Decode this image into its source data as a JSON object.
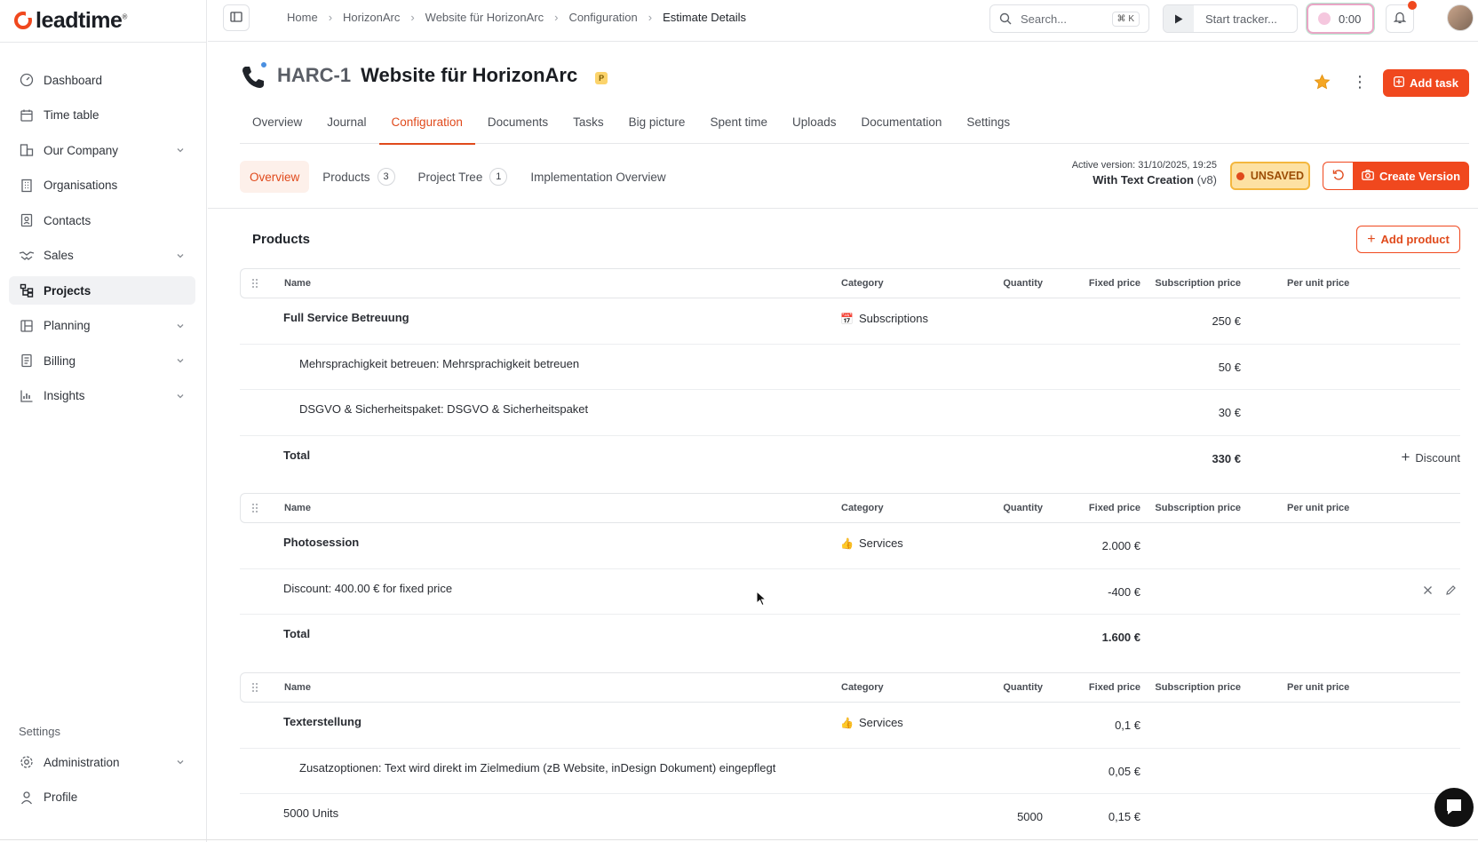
{
  "app": {
    "logo_text": "leadtime",
    "logo_sup": "®"
  },
  "sidebar": {
    "items": [
      {
        "label": "Dashboard",
        "icon": "gauge-icon"
      },
      {
        "label": "Time table",
        "icon": "calendar-icon"
      },
      {
        "label": "Our Company",
        "icon": "buildings-icon"
      },
      {
        "label": "Organisations",
        "icon": "building-icon"
      },
      {
        "label": "Contacts",
        "icon": "contact-icon"
      },
      {
        "label": "Sales",
        "icon": "handshake-icon"
      },
      {
        "label": "Projects",
        "icon": "diagram-icon"
      },
      {
        "label": "Planning",
        "icon": "board-icon"
      },
      {
        "label": "Billing",
        "icon": "document-icon"
      },
      {
        "label": "Insights",
        "icon": "chart-icon"
      }
    ],
    "settings_label": "Settings",
    "bottom_items": [
      {
        "label": "Administration",
        "icon": "gear-icon"
      },
      {
        "label": "Profile",
        "icon": "user-icon"
      }
    ]
  },
  "topbar": {
    "breadcrumb": [
      "Home",
      "HorizonArc",
      "Website für HorizonArc",
      "Configuration",
      "Estimate Details"
    ],
    "search_placeholder": "Search...",
    "search_shortcut": "⌘ K",
    "tracker_label": "Start tracker...",
    "timer_value": "0:00"
  },
  "header": {
    "project_id": "HARC-1",
    "project_title": "Website für HorizonArc",
    "badge": "P",
    "add_task_label": "Add task"
  },
  "tabs": [
    "Overview",
    "Journal",
    "Configuration",
    "Documents",
    "Tasks",
    "Big picture",
    "Spent time",
    "Uploads",
    "Documentation",
    "Settings"
  ],
  "subtabs": {
    "overview": "Overview",
    "products": "Products",
    "products_count": "3",
    "project_tree": "Project Tree",
    "project_tree_count": "1",
    "implementation": "Implementation Overview"
  },
  "version": {
    "active_label": "Active version:",
    "active_date": "31/10/2025, 19:25",
    "name": "With Text Creation",
    "tag": "(v8)",
    "status": "UNSAVED",
    "create_label": "Create Version"
  },
  "products": {
    "title": "Products",
    "add_label": "Add product",
    "columns": {
      "name": "Name",
      "category": "Category",
      "quantity": "Quantity",
      "fixed": "Fixed price",
      "subscription": "Subscription price",
      "unit": "Per unit price"
    },
    "discount_label": "Discount",
    "groups": [
      {
        "rows": [
          {
            "name": "Full Service Betreuung",
            "category": "Subscriptions",
            "cat_icon": "📅",
            "subscription": "250 €"
          },
          {
            "name": "Mehrsprachigkeit betreuen:  Mehrsprachigkeit betreuen",
            "subscription": "50 €"
          },
          {
            "name": "DSGVO & Sicherheitspaket:  DSGVO & Sicherheitspaket",
            "subscription": "30 €"
          },
          {
            "name": "Total",
            "subscription": "330 €"
          }
        ]
      },
      {
        "rows": [
          {
            "name": "Photosession",
            "category": "Services",
            "cat_icon": "👍",
            "fixed": "2.000 €"
          },
          {
            "name": "Discount: 400.00 € for fixed price",
            "fixed": "-400 €"
          },
          {
            "name": "Total",
            "fixed": "1.600 €"
          }
        ]
      },
      {
        "rows": [
          {
            "name": "Texterstellung",
            "category": "Services",
            "cat_icon": "👍",
            "fixed": "0,1 €"
          },
          {
            "name": "Zusatzoptionen:  Text wird direkt im Zielmedium (zB Website, inDesign Dokument) eingepflegt",
            "fixed": "0,05 €"
          },
          {
            "name": "5000 Units",
            "quantity": "5000",
            "fixed": "0,15 €"
          }
        ]
      }
    ]
  },
  "colors": {
    "accent": "#f0481e",
    "warning_bg": "#fde1a3",
    "warning_border": "#f4b73f"
  }
}
